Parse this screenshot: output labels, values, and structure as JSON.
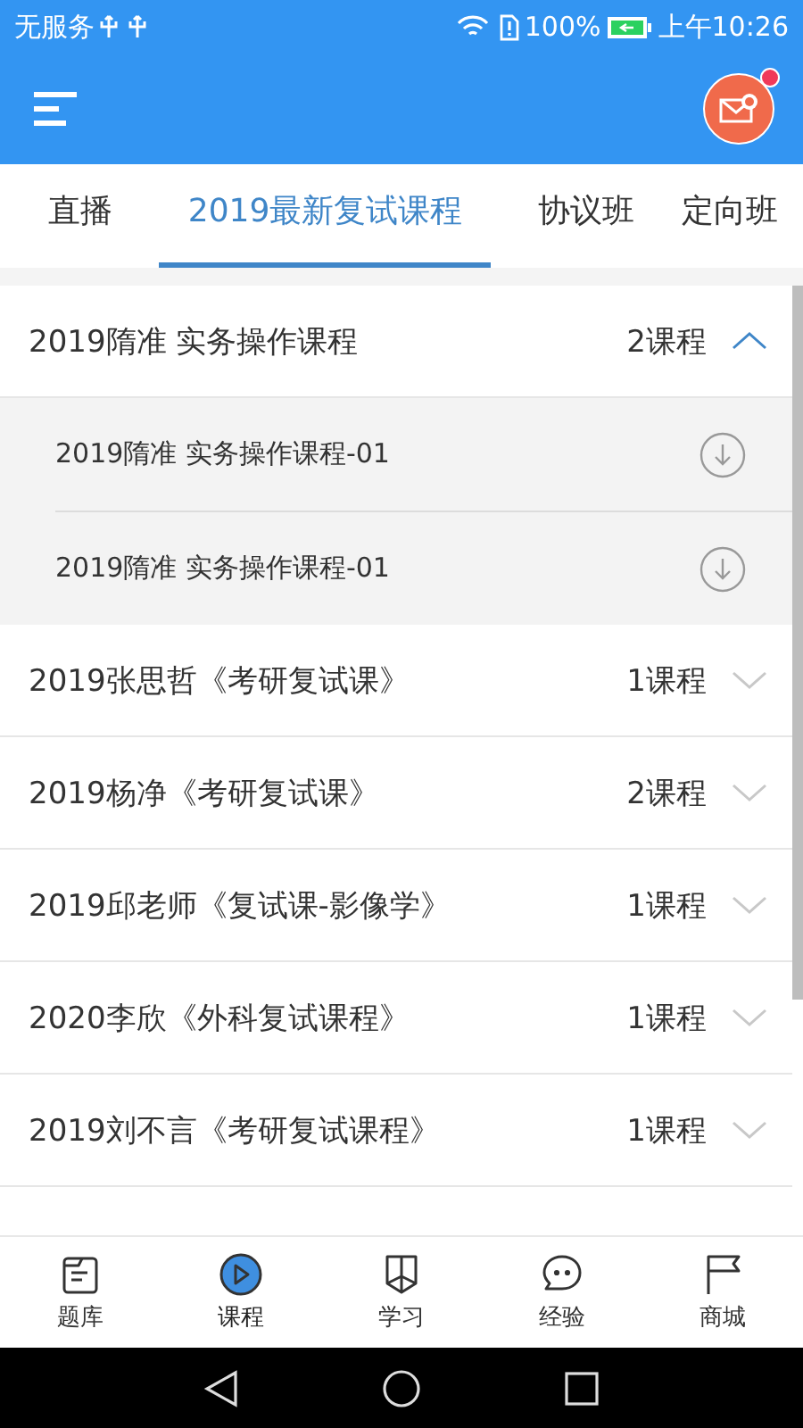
{
  "status_bar": {
    "carrier": "无服务",
    "battery": "100%",
    "time": "上午10:26"
  },
  "header": {
    "has_notification": true
  },
  "tabs": [
    {
      "label": "直播",
      "selected": false
    },
    {
      "label": "2019最新复试课程",
      "selected": true
    },
    {
      "label": "协议班",
      "selected": false
    },
    {
      "label": "定向班",
      "selected": false
    }
  ],
  "courses": [
    {
      "title": "2019隋准 实务操作课程",
      "count": "2课程",
      "expanded": true,
      "lessons": [
        {
          "title": "2019隋准 实务操作课程-01"
        },
        {
          "title": "2019隋准 实务操作课程-01"
        }
      ]
    },
    {
      "title": "2019张思哲《考研复试课》",
      "count": "1课程",
      "expanded": false
    },
    {
      "title": "2019杨净《考研复试课》",
      "count": "2课程",
      "expanded": false
    },
    {
      "title": "2019邱老师《复试课-影像学》",
      "count": "1课程",
      "expanded": false
    },
    {
      "title": "2020李欣《外科复试课程》",
      "count": "1课程",
      "expanded": false
    },
    {
      "title": "2019刘不言《考研复试课程》",
      "count": "1课程",
      "expanded": false
    }
  ],
  "bottom_nav": [
    {
      "kind": "bank",
      "label": "题库",
      "selected": false
    },
    {
      "kind": "course",
      "label": "课程",
      "selected": true
    },
    {
      "kind": "study",
      "label": "学习",
      "selected": false
    },
    {
      "kind": "chat",
      "label": "经验",
      "selected": false
    },
    {
      "kind": "shop",
      "label": "商城",
      "selected": false
    }
  ]
}
